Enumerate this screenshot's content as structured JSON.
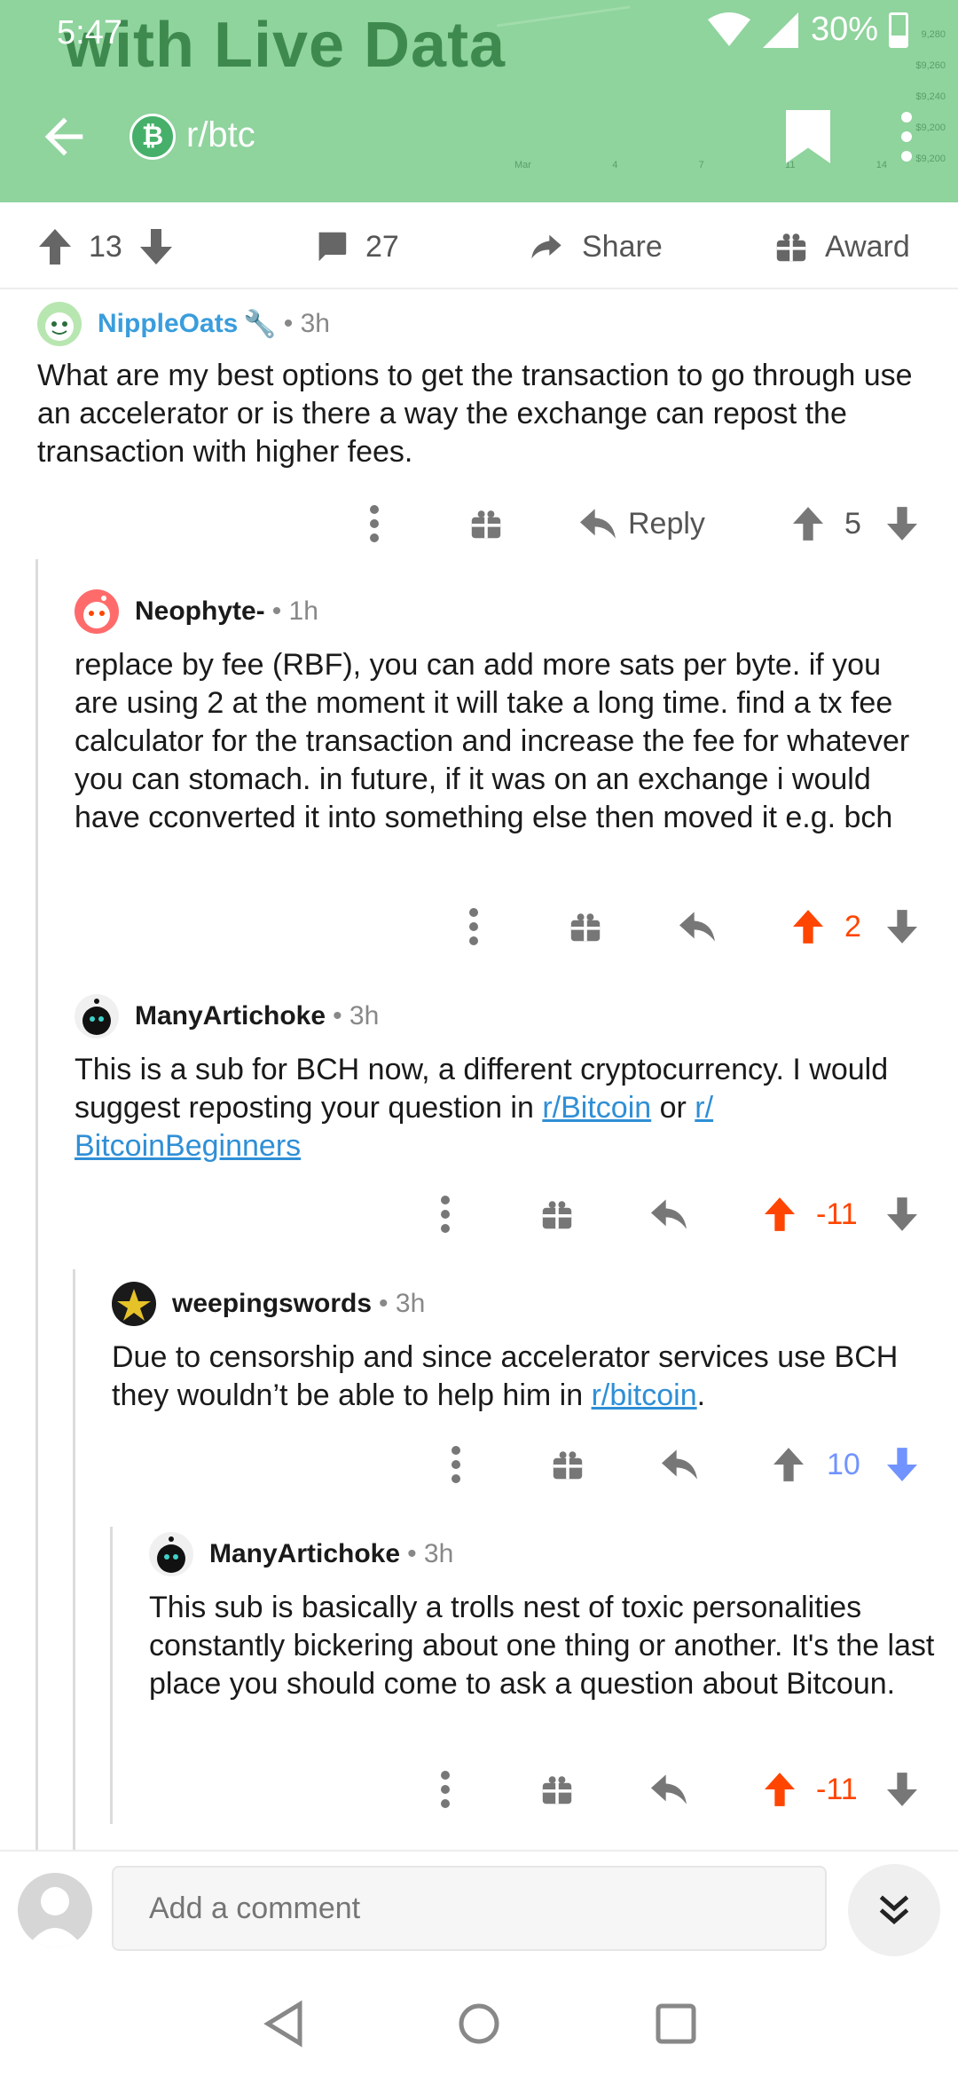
{
  "status_bar": {
    "time": "5:47",
    "battery": "30%"
  },
  "header": {
    "background_text": "with Live Data",
    "subreddit": "r/btc",
    "subreddit_icon_letter": "₿",
    "chart_y_ticks": [
      "9,280",
      "$9,260",
      "$9,240",
      "$9,200",
      "$9,200"
    ],
    "chart_x_ticks": [
      "Mar",
      "4",
      "7",
      "11",
      "14"
    ]
  },
  "post_actions": {
    "score": "13",
    "comments": "27",
    "share_label": "Share",
    "award_label": "Award"
  },
  "comments": [
    {
      "author": "NippleOats",
      "is_op": true,
      "time": "3h",
      "body": "What are my best options to get the transaction to go through use an accelerator or is there a way the exchange can repost the transaction with higher fees.",
      "score": "5",
      "vote": "none",
      "reply_label": "Reply"
    },
    {
      "author": "Neophyte-",
      "time": "1h",
      "body": "replace by fee (RBF), you can add more sats per byte. if you are using 2 at the moment it will take a long time. find a tx fee calculator for the transaction and increase the fee for whatever you can stomach. in future, if it was on an exchange i would have cconverted it into something else then moved it e.g. bch",
      "score": "2",
      "vote": "up"
    },
    {
      "author": "ManyArtichoke",
      "time": "3h",
      "body_prefix": "This is a sub for BCH now, a different cryptocurrency. I would suggest reposting your question in ",
      "link1": "r/Bitcoin",
      "body_mid": " or ",
      "link2": "r/ BitcoinBeginners",
      "score": "-11",
      "vote": "up"
    },
    {
      "author": "weepingswords",
      "time": "3h",
      "body_prefix": "Due to censorship and since accelerator services use BCH they wouldn’t be able to help him in ",
      "link1": "r/bitcoin",
      "body_suffix": ".",
      "score": "10",
      "vote": "down"
    },
    {
      "author": "ManyArtichoke",
      "time": "3h",
      "body": "This sub is basically a trolls nest of toxic personalities constantly bickering about one thing or another. It's the last place you should come to ask a question about Bitcoun.",
      "score": "-11",
      "vote": "up"
    }
  ],
  "composer": {
    "placeholder": "Add a comment"
  },
  "colors": {
    "header": "#8fd39d",
    "upvote": "#ff4500",
    "downvote": "#7193ff",
    "op": "#3a9ddc",
    "link": "#2f8fd6"
  }
}
